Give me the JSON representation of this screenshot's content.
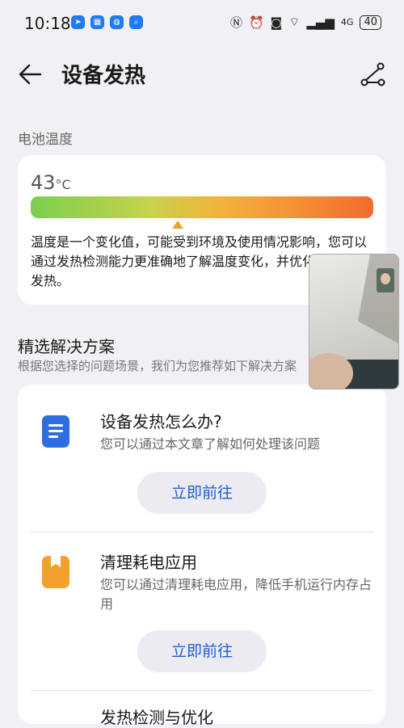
{
  "status_bar": {
    "time": "10:18",
    "battery": "40",
    "network": "4G",
    "app_icons": [
      "nav-app-icon",
      "grid-app-icon",
      "globe-app-icon",
      "search-app-icon"
    ]
  },
  "header": {
    "title": "设备发热"
  },
  "battery_temp": {
    "section_label": "电池温度",
    "value": "43",
    "unit": "°C",
    "level_fraction": 0.43,
    "gradient_colors": [
      "#7bcf4e",
      "#f2b33b",
      "#f26b30"
    ],
    "description": "温度是一个变化值，可能受到环境及使用情况影响，您可以通过发热检测能力更准确地了解温度变化，并优化项目缓解发热。"
  },
  "solutions": {
    "title": "精选解决方案",
    "subtitle": "根据您选择的问题场景，我们为您推荐如下解决方案",
    "items": [
      {
        "icon": "document-icon",
        "title": "设备发热怎么办?",
        "description": "您可以通过本文章了解如何处理该问题",
        "button": "立即前往"
      },
      {
        "icon": "bookmark-icon",
        "title": "清理耗电应用",
        "description": "您可以通过清理耗电应用，降低手机运行内存占用",
        "button": "立即前往"
      },
      {
        "title": "发热检测与优化"
      }
    ]
  },
  "colors": {
    "accent": "#1d5fd1",
    "card": "#ffffff",
    "background": "#f1f0f5"
  }
}
